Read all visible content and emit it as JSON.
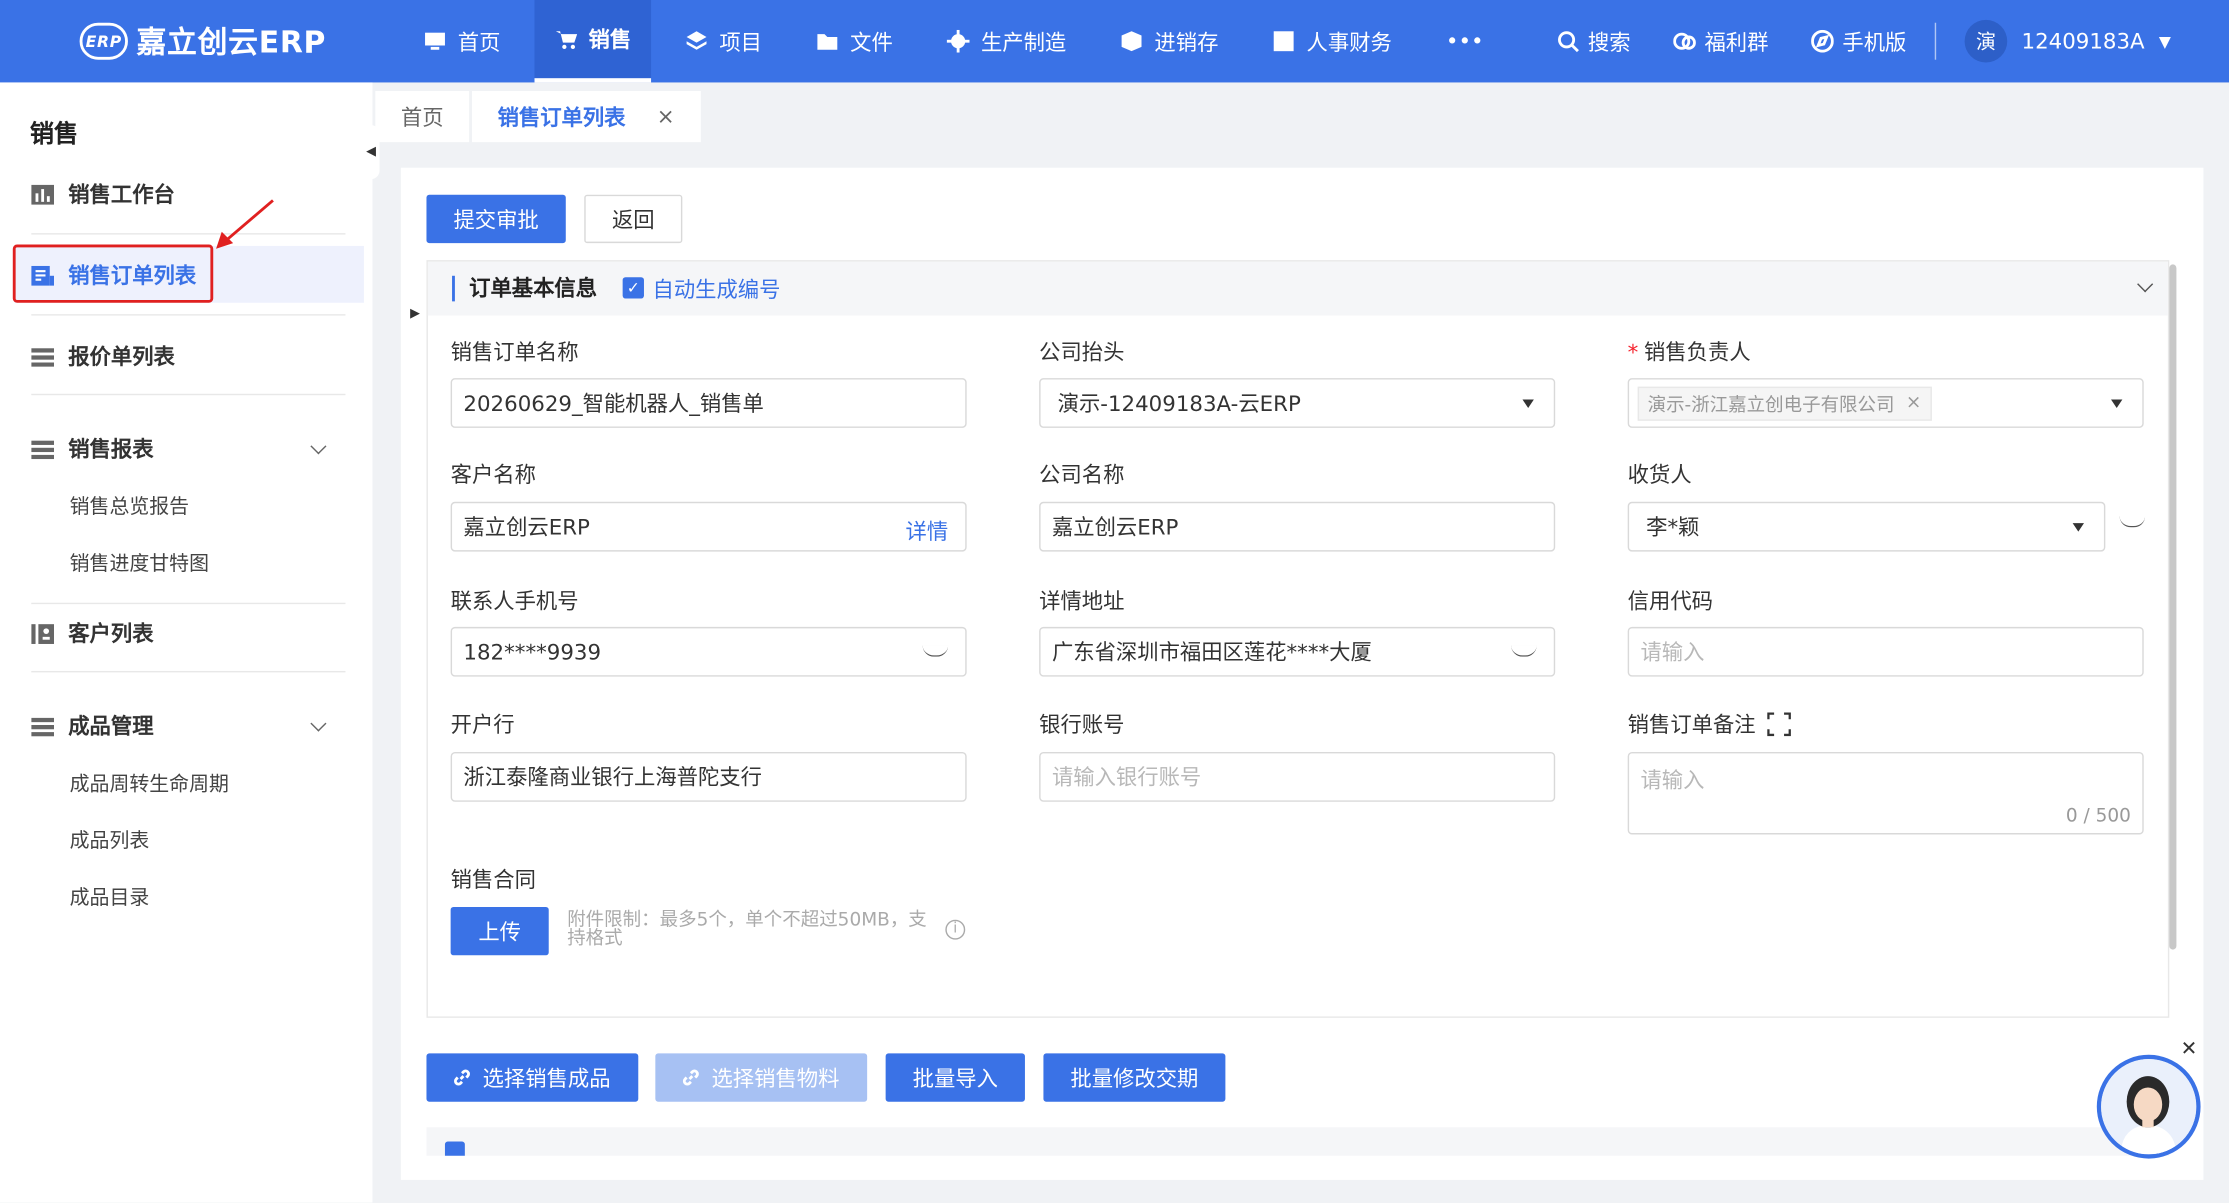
{
  "app": {
    "logo_badge": "ERP",
    "logo_text": "嘉立创云ERP"
  },
  "nav": [
    {
      "label": "首页",
      "icon": "monitor-icon"
    },
    {
      "label": "销售",
      "icon": "cart-icon",
      "active": true
    },
    {
      "label": "项目",
      "icon": "layers-icon"
    },
    {
      "label": "文件",
      "icon": "folder-icon"
    },
    {
      "label": "生产制造",
      "icon": "gear-icon"
    },
    {
      "label": "进销存",
      "icon": "box-icon"
    },
    {
      "label": "人事财务",
      "icon": "finance-icon"
    },
    {
      "label": "•••",
      "icon": "more-icon"
    }
  ],
  "tools": {
    "search": "搜索",
    "welfare": "福利群",
    "mobile": "手机版"
  },
  "user": {
    "avatar_char": "演",
    "id": "12409183A"
  },
  "sidebar": {
    "title": "销售",
    "items": {
      "workbench": "销售工作台",
      "order_list": "销售订单列表",
      "quote_list": "报价单列表",
      "reports": "销售报表",
      "report_overview": "销售总览报告",
      "report_gantt": "销售进度甘特图",
      "customers": "客户列表",
      "product_mgmt": "成品管理",
      "product_lifecycle": "成品周转生命周期",
      "product_list": "成品列表",
      "product_catalog": "成品目录"
    }
  },
  "tabs": {
    "home": "首页",
    "current": "销售订单列表",
    "close": "×"
  },
  "actions": {
    "submit": "提交审批",
    "back": "返回"
  },
  "section": {
    "title": "订单基本信息",
    "auto_number": "自动生成编号",
    "auto_number_checked": "✓"
  },
  "form": {
    "order_name": {
      "label": "销售订单名称",
      "value": "20260629_智能机器人_销售单"
    },
    "company_header": {
      "label": "公司抬头",
      "value": "演示-12409183A-云ERP"
    },
    "sales_owner": {
      "label": "销售负责人",
      "value": "演示-浙江嘉立创电子有限公司",
      "remove": "×"
    },
    "customer_name": {
      "label": "客户名称",
      "value": "嘉立创云ERP",
      "detail_link": "详情"
    },
    "company_name": {
      "label": "公司名称",
      "value": "嘉立创云ERP"
    },
    "consignee": {
      "label": "收货人",
      "value": "李*颖"
    },
    "contact_phone": {
      "label": "联系人手机号",
      "value": "182****9939"
    },
    "address": {
      "label": "详情地址",
      "value": "广东省深圳市福田区莲花****大厦"
    },
    "credit_code": {
      "label": "信用代码",
      "placeholder": "请输入"
    },
    "bank": {
      "label": "开户行",
      "value": "浙江泰隆商业银行上海普陀支行"
    },
    "bank_account": {
      "label": "银行账号",
      "placeholder": "请输入银行账号"
    },
    "remark": {
      "label": "销售订单备注",
      "placeholder": "请输入",
      "counter": "0 / 500"
    },
    "contract": {
      "label": "销售合同",
      "upload": "上传",
      "note": "附件限制：最多5个，单个不超过50MB，支持格式",
      "info": "i"
    }
  },
  "bottom_actions": {
    "select_products": "选择销售成品",
    "select_materials": "选择销售物料",
    "batch_import": "批量导入",
    "batch_edit_date": "批量修改交期"
  },
  "colors": {
    "primary": "#3a72e6",
    "required": "#f5222d",
    "annotation": "#e02020"
  }
}
